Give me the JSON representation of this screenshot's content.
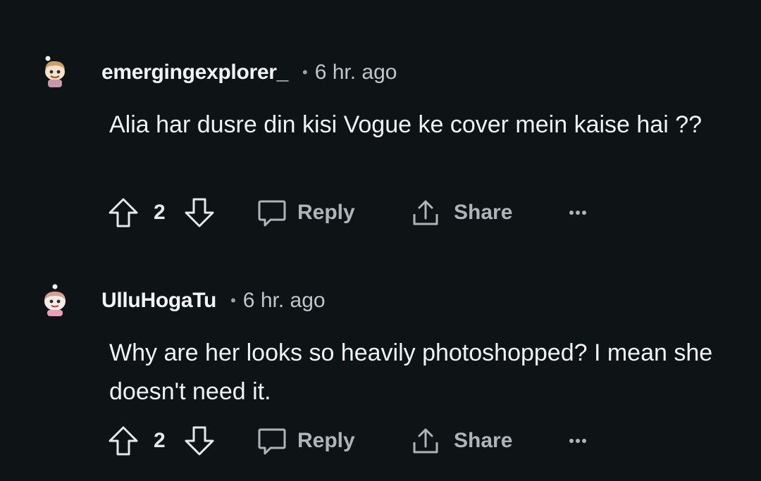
{
  "comments": [
    {
      "username": "emergingexplorer_",
      "separator": "•",
      "time": "6 hr. ago",
      "text": "Alia har dusre din kisi Vogue ke cover mein kaise hai ??",
      "votes": "2",
      "reply_label": "Reply",
      "share_label": "Share",
      "avatar_icon": "snoo-avatar-icon",
      "avatar_accent": "#c59aa6"
    },
    {
      "username": "UlluHogaTu",
      "separator": "•",
      "time": "6 hr. ago",
      "text": "Why are her looks so heavily photoshopped? I mean she doesn't need it.",
      "votes": "2",
      "reply_label": "Reply",
      "share_label": "Share",
      "avatar_icon": "snoo-avatar-icon",
      "avatar_accent": "#e8a0b4"
    }
  ],
  "theme": {
    "background": "#0e1316",
    "text": "#f0f2f3",
    "muted": "#aeb5b9"
  }
}
